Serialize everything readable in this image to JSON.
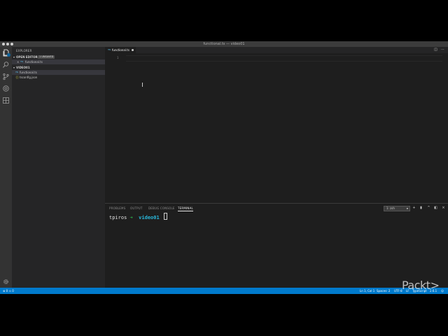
{
  "window": {
    "title": "functional.ts — video01"
  },
  "activity_bar": {
    "icons": [
      "files-icon",
      "search-icon",
      "source-control-icon",
      "debug-icon",
      "extensions-icon"
    ],
    "settings_icon": "gear-icon"
  },
  "sidebar": {
    "title": "EXPLORER",
    "open_editors": {
      "label": "OPEN EDITORS",
      "badge": "1 UNSAVED",
      "items": [
        {
          "type": "TS",
          "name": "functional.ts"
        }
      ]
    },
    "folder": {
      "label": "VIDEO01",
      "items": [
        {
          "type": "TS",
          "name": "functional.ts"
        },
        {
          "type": "{}",
          "name": "tsconfig.json"
        }
      ]
    }
  },
  "editor": {
    "tab": {
      "type": "TS",
      "name": "functional.ts"
    },
    "line_number": "1"
  },
  "panel": {
    "tabs": [
      "PROBLEMS",
      "OUTPUT",
      "DEBUG CONSOLE",
      "TERMINAL"
    ],
    "active_tab": "TERMINAL",
    "terminal_select": "1: zsh",
    "prompt_user": "tpiros",
    "prompt_arrow": "➜",
    "prompt_dir": "video01"
  },
  "statusbar": {
    "problems": "⊗ 0 ⚠ 0",
    "position": "Ln 1, Col 1",
    "spaces": "Spaces: 2",
    "encoding": "UTF-8",
    "eol": "LF",
    "language": "TypeScript",
    "version": "2.6.1",
    "smiley": "☺"
  },
  "watermark": "Packt>",
  "colors": {
    "accent": "#007acc",
    "ts": "#519aba",
    "json": "#cbcb41",
    "terminal_dir": "#29b8db",
    "terminal_arrow": "#2db34a"
  }
}
